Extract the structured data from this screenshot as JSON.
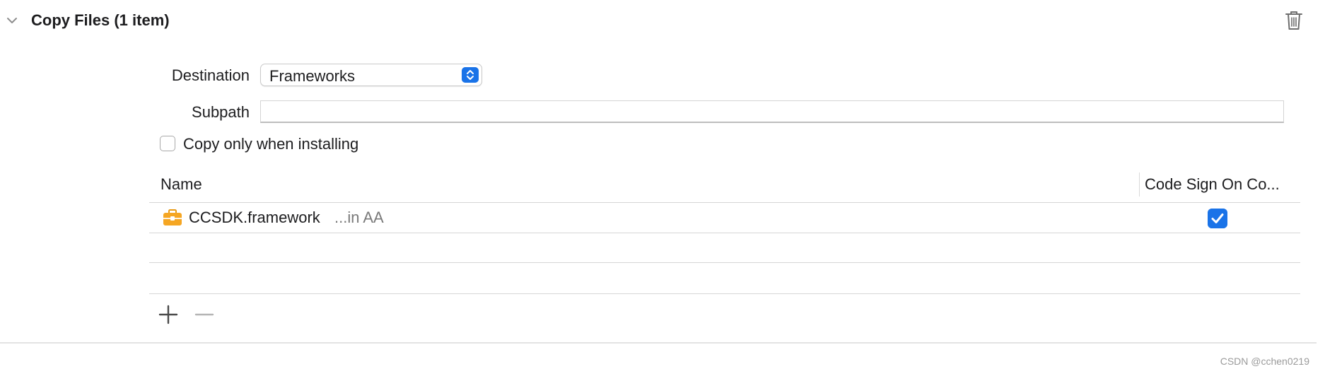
{
  "phase": {
    "title": "Copy Files (1 item)",
    "disclosure_icon": "chevron-down-icon",
    "delete_icon": "trash-icon"
  },
  "form": {
    "destination_label": "Destination",
    "destination_value": "Frameworks",
    "subpath_label": "Subpath",
    "subpath_value": "",
    "copy_only_label": "Copy only when installing",
    "copy_only_checked": false
  },
  "table": {
    "columns": [
      "Name",
      "Code Sign On Co..."
    ],
    "rows": [
      {
        "name": "CCSDK.framework",
        "location": "...in AA",
        "icon": "framework-toolbox-icon",
        "code_sign_on_copy": true
      }
    ],
    "add_icon": "plus-icon",
    "remove_icon": "minus-icon"
  },
  "watermark": "CSDN @cchen0219",
  "colors": {
    "accent": "#1a73e8",
    "framework_icon": "#f5a623",
    "separator": "#d6d6d6",
    "secondary_text": "#7a7a7a"
  }
}
